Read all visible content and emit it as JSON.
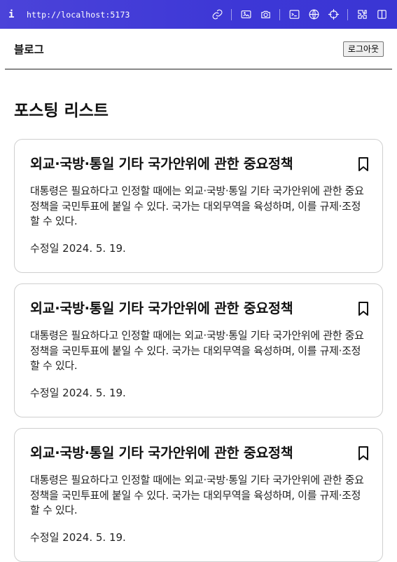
{
  "browser": {
    "info_glyph": "i",
    "url": "http://localhost:5173",
    "tool_icons": [
      "link-icon",
      "image-off-icon",
      "camera-icon",
      "terminal-icon",
      "globe-icon",
      "crosshair-icon",
      "extension-icon",
      "sidebar-icon"
    ]
  },
  "header": {
    "brand": "블로그",
    "logout_label": "로그아웃"
  },
  "main": {
    "page_title": "포스팅 리스트",
    "posts": [
      {
        "title": "외교·국방·통일 기타 국가안위에 관한 중요정책",
        "body": "대통령은 필요하다고 인정할 때에는 외교·국방·통일 기타 국가안위에 관한 중요정책을 국민투표에 붙일 수 있다. 국가는 대외무역을 육성하며, 이를 규제·조정할 수 있다.",
        "date": "수정일 2024. 5. 19."
      },
      {
        "title": "외교·국방·통일 기타 국가안위에 관한 중요정책",
        "body": "대통령은 필요하다고 인정할 때에는 외교·국방·통일 기타 국가안위에 관한 중요정책을 국민투표에 붙일 수 있다. 국가는 대외무역을 육성하며, 이를 규제·조정할 수 있다.",
        "date": "수정일 2024. 5. 19."
      },
      {
        "title": "외교·국방·통일 기타 국가안위에 관한 중요정책",
        "body": "대통령은 필요하다고 인정할 때에는 외교·국방·통일 기타 국가안위에 관한 중요정책을 국민투표에 붙일 수 있다. 국가는 대외무역을 육성하며, 이를 규제·조정할 수 있다.",
        "date": "수정일 2024. 5. 19."
      }
    ]
  },
  "colors": {
    "browser_bar": "#3d37d6",
    "card_border": "#cfcfcf"
  }
}
